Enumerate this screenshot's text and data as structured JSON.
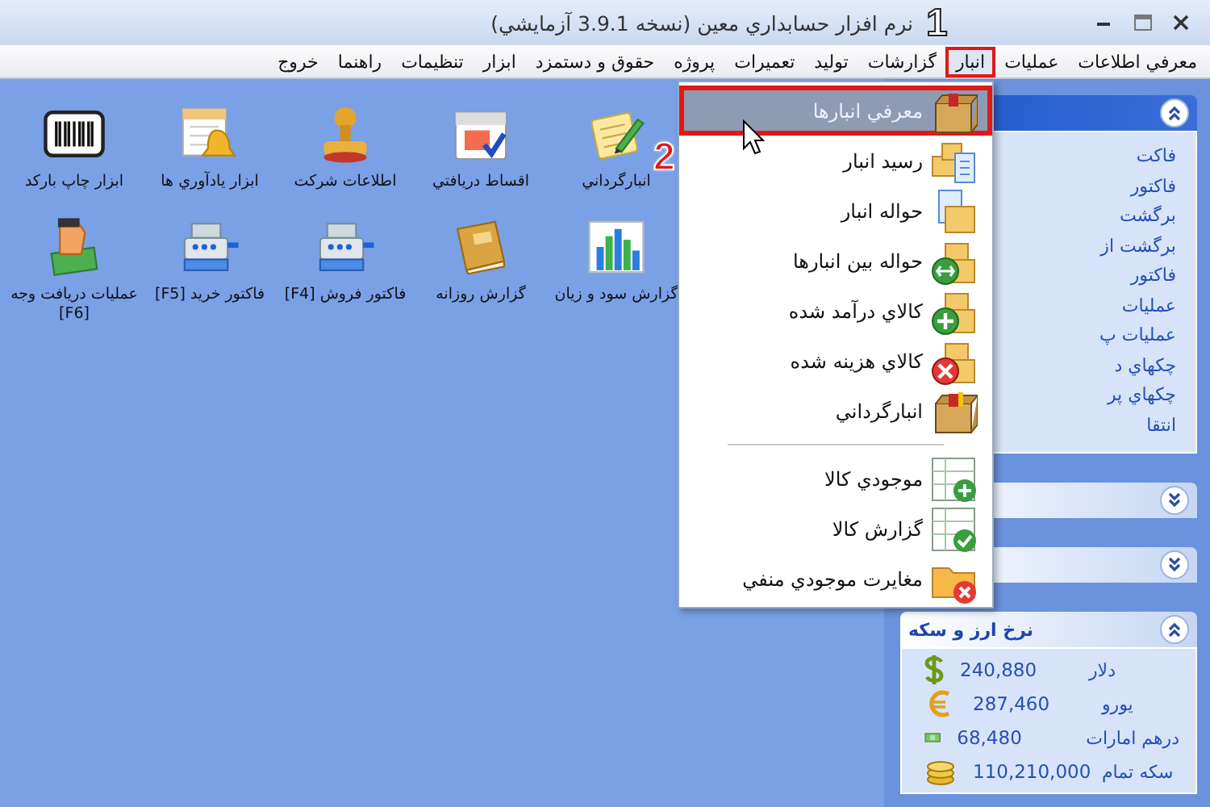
{
  "window": {
    "title": "نرم افزار حسابداري معين (نسخه 3.9.1 آزمايشي)"
  },
  "menu_bar": [
    {
      "label": "معرفي اطلاعات",
      "selected": false
    },
    {
      "label": "عمليات",
      "selected": false
    },
    {
      "label": "انبار",
      "selected": true
    },
    {
      "label": "گزارشات",
      "selected": false
    },
    {
      "label": "توليد",
      "selected": false
    },
    {
      "label": "تعميرات",
      "selected": false
    },
    {
      "label": "پروژه",
      "selected": false
    },
    {
      "label": "حقوق و دستمزد",
      "selected": false
    },
    {
      "label": "ابزار",
      "selected": false
    },
    {
      "label": "تنظيمات",
      "selected": false
    },
    {
      "label": "راهنما",
      "selected": false
    },
    {
      "label": "خروج",
      "selected": false
    }
  ],
  "desktop_icons": [
    "انبارگرداني",
    "اقساط دريافتي",
    "اطلاعات شرکت",
    "ابزار يادآوري ها",
    "ابزار چاپ بارکد",
    "گزارش سود و زيان",
    "گزارش روزانه",
    "فاکتور فروش [F4]",
    "فاکتور خريد [F5]",
    "عمليات دريافت وجه [F6]"
  ],
  "dropdown": {
    "items": [
      {
        "kind": "item",
        "label": "معرفي انبارها",
        "selected": true
      },
      {
        "kind": "item",
        "label": "رسيد انبار",
        "selected": false
      },
      {
        "kind": "item",
        "label": "حواله انبار",
        "selected": false
      },
      {
        "kind": "item",
        "label": "حواله بين انبارها",
        "selected": false
      },
      {
        "kind": "item",
        "label": "کالاي درآمد شده",
        "selected": false
      },
      {
        "kind": "item",
        "label": "کالاي هزينه شده",
        "selected": false
      },
      {
        "kind": "item",
        "label": "انبارگرداني",
        "selected": false
      },
      {
        "kind": "separator"
      },
      {
        "kind": "item",
        "label": "موجودي کالا",
        "selected": false
      },
      {
        "kind": "item",
        "label": "گزارش کالا",
        "selected": false
      },
      {
        "kind": "item",
        "label": "مغايرت موجودي منفي",
        "selected": false
      }
    ]
  },
  "task_pane": {
    "sections": [
      {
        "expanded": true,
        "links": [
          "فاکت",
          "فاکتور",
          "برگشت",
          "برگشت از",
          "فاکتور",
          "عمليات",
          "عمليات پ",
          "چکهاي د",
          "چکهاي پر",
          "انتقا"
        ]
      },
      {
        "expanded": false
      },
      {
        "expanded": false
      },
      {
        "title": "نرخ ارز و سکه",
        "expanded": true,
        "rates": [
          {
            "name": "دلار",
            "value": "240,880"
          },
          {
            "name": "يورو",
            "value": "287,460"
          },
          {
            "name": "درهم امارات",
            "value": "68,480"
          },
          {
            "name": "سکه تمام",
            "value": "110,210,000"
          }
        ]
      }
    ]
  },
  "annotations": [
    "1",
    "2"
  ]
}
